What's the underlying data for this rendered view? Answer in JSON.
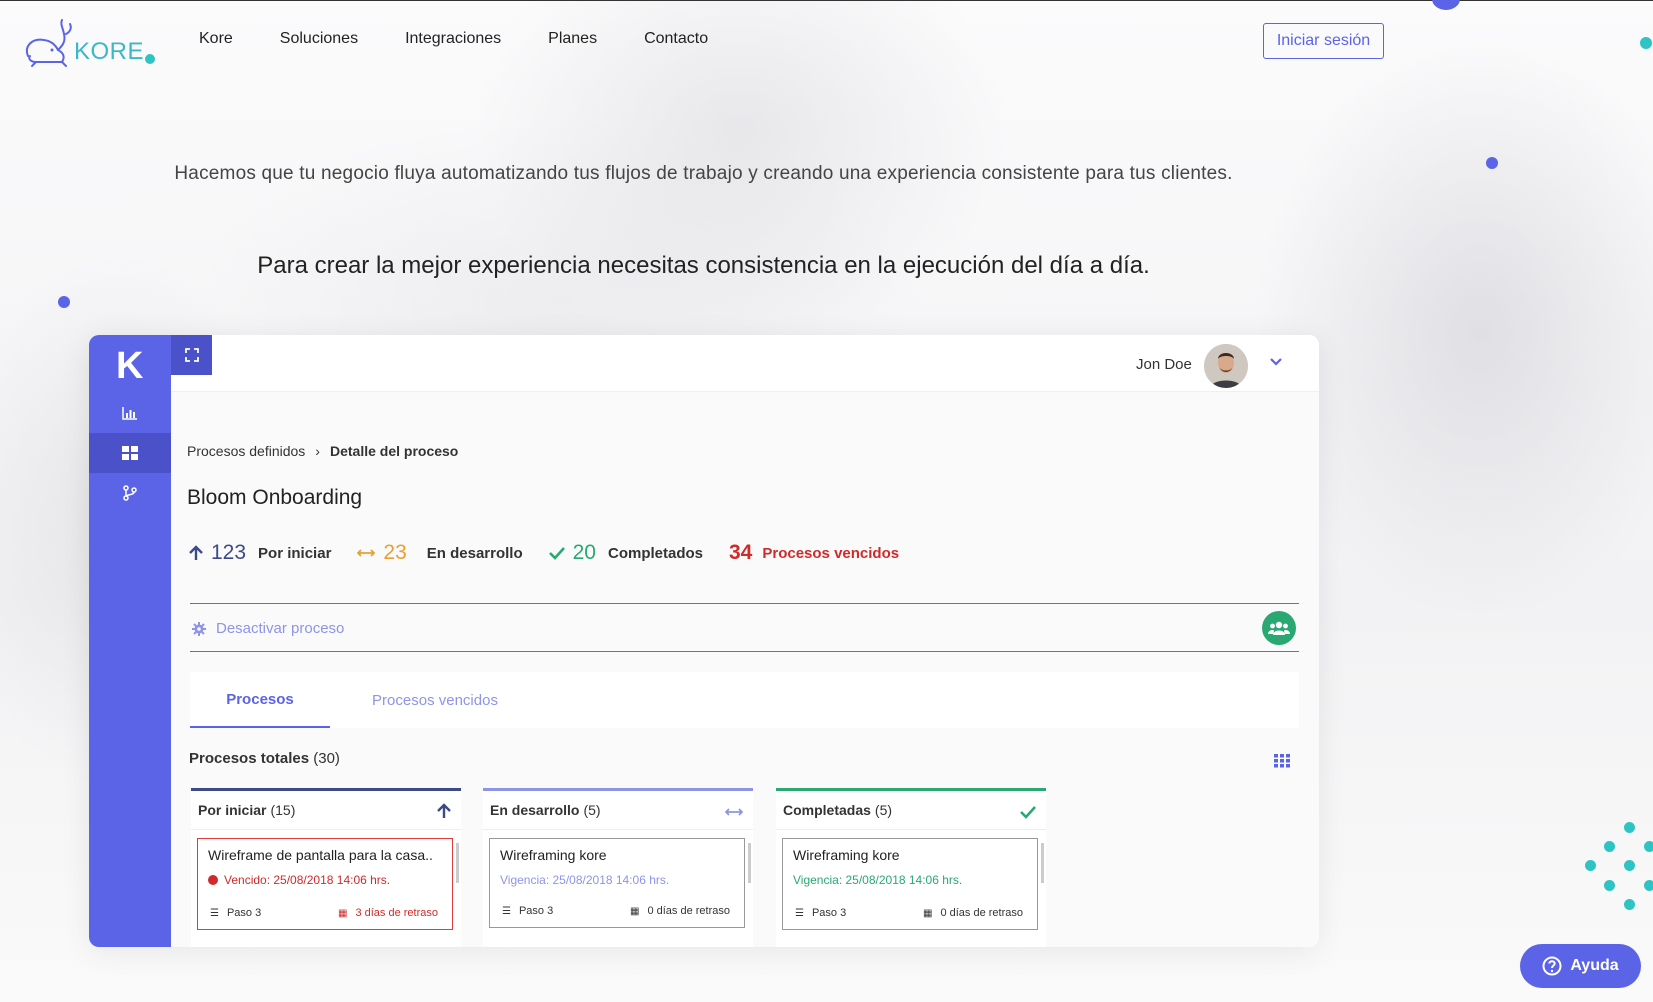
{
  "brand": {
    "logo_text": "KORE"
  },
  "nav": {
    "items": [
      "Kore",
      "Soluciones",
      "Integraciones",
      "Planes",
      "Contacto"
    ],
    "login_label": "Iniciar sesión"
  },
  "hero": {
    "subtitle": "Hacemos que tu negocio fluya automatizando tus flujos de trabajo y creando una experiencia consistente para tus clientes.",
    "title": "Para crear la mejor experiencia necesitas consistencia en la ejecución del día a día."
  },
  "app": {
    "sidebar_logo": "K",
    "user": {
      "name": "Jon Doe"
    },
    "breadcrumb": {
      "parent": "Procesos definidos",
      "current": "Detalle del proceso"
    },
    "process_title": "Bloom Onboarding",
    "stats": [
      {
        "value": "123",
        "label": "Por iniciar",
        "color": "#3d4a8a"
      },
      {
        "value": "23",
        "label": "En desarrollo",
        "color": "#e8a030"
      },
      {
        "value": "20",
        "label": "Completados",
        "color": "#2aa872"
      },
      {
        "value": "34",
        "label": "Procesos vencidos",
        "color": "#d02a2a"
      }
    ],
    "deactivate_label": "Desactivar proceso",
    "tabs": [
      "Procesos",
      "Procesos vencidos"
    ],
    "totals": {
      "label": "Procesos totales",
      "count": "(30)"
    },
    "columns": [
      {
        "title": "Por iniciar",
        "count": "(15)",
        "color": "#3d4a8a",
        "card": {
          "title": "Wireframe de pantalla para la casa..",
          "date": "Vencido: 25/08/2018   14:06 hrs.",
          "step": "Paso 3",
          "delay": "3 días de retraso"
        }
      },
      {
        "title": "En desarrollo",
        "count": "(5)",
        "color": "#8e94e8",
        "card": {
          "title": "Wireframing kore",
          "date": "Vigencia: 25/08/2018   14:06 hrs.",
          "step": "Paso 3",
          "delay": "0 días de retraso"
        }
      },
      {
        "title": "Completadas",
        "count": "(5)",
        "color": "#2aa872",
        "card": {
          "title": "Wireframing kore",
          "date": "Vigencia: 25/08/2018   14:06 hrs.",
          "step": "Paso 3",
          "delay": "0 días de retraso"
        }
      }
    ]
  },
  "help": {
    "label": "Ayuda"
  },
  "colors": {
    "accent": "#5b63e6",
    "teal": "#2ec4c4",
    "green": "#2aa872",
    "red": "#d02a2a",
    "orange": "#e8a030"
  }
}
